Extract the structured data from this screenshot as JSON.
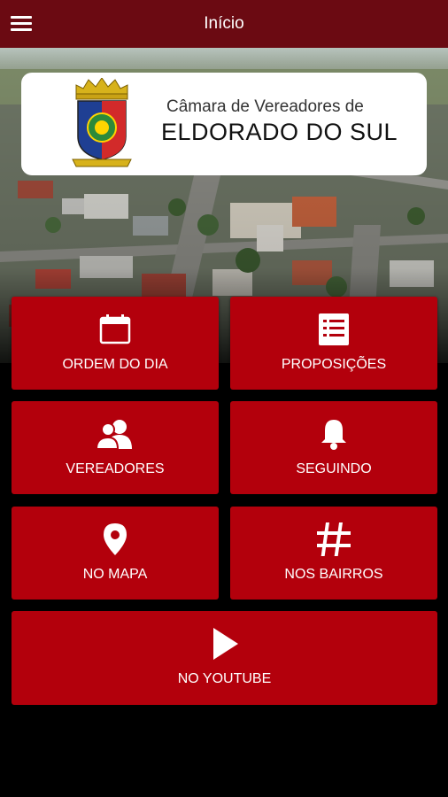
{
  "app_bar": {
    "title": "Início",
    "menu_icon": "hamburger-menu-icon"
  },
  "header": {
    "org_line1": "Câmara de Vereadores de",
    "org_line2": "ELDORADO DO SUL"
  },
  "colors": {
    "app_bar": "#6b0a12",
    "tile": "#b3000c"
  },
  "tiles": [
    {
      "label": "ORDEM DO DIA",
      "icon": "calendar-icon"
    },
    {
      "label": "PROPOSIÇÕES",
      "icon": "list-document-icon"
    },
    {
      "label": "VEREADORES",
      "icon": "users-icon"
    },
    {
      "label": "SEGUINDO",
      "icon": "bell-icon"
    },
    {
      "label": "NO MAPA",
      "icon": "map-pin-icon"
    },
    {
      "label": "NOS BAIRROS",
      "icon": "hashtag-icon"
    },
    {
      "label": "NO YOUTUBE",
      "icon": "play-icon"
    }
  ]
}
